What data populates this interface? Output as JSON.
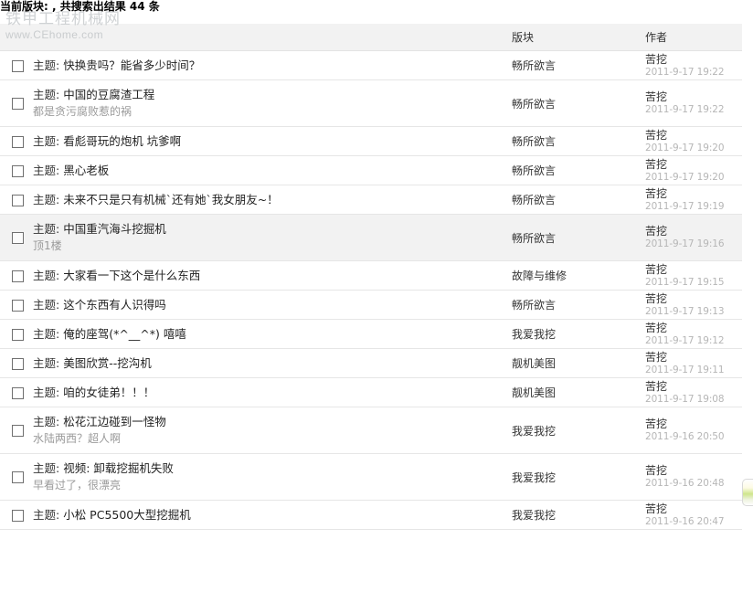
{
  "summary": {
    "text": "当前版块: , 共搜索出结果 44 条"
  },
  "watermark": {
    "cn": "铁甲工程机械网",
    "en": "www.CEhome.com"
  },
  "table": {
    "headers": {
      "checkbox": "",
      "title": "",
      "forum": "版块",
      "author": "作者"
    },
    "rows": [
      {
        "title_label": "主题:",
        "title": "快换贵吗？能省多少时间？",
        "sub": "",
        "forum": "畅所欲言",
        "author": "苦挖",
        "date": "2011-9-17 19:22",
        "highlight": false
      },
      {
        "title_label": "主题:",
        "title": "中国的豆腐渣工程",
        "sub": "都是贪污腐败惹的祸",
        "forum": "畅所欲言",
        "author": "苦挖",
        "date": "2011-9-17 19:22",
        "highlight": false
      },
      {
        "title_label": "主题:",
        "title": "看彪哥玩的炮机 坑爹啊",
        "sub": "",
        "forum": "畅所欲言",
        "author": "苦挖",
        "date": "2011-9-17 19:20",
        "highlight": false
      },
      {
        "title_label": "主题:",
        "title": "黑心老板",
        "sub": "",
        "forum": "畅所欲言",
        "author": "苦挖",
        "date": "2011-9-17 19:20",
        "highlight": false
      },
      {
        "title_label": "主题:",
        "title": "未来不只是只有机械`还有她`我女朋友~！",
        "sub": "",
        "forum": "畅所欲言",
        "author": "苦挖",
        "date": "2011-9-17 19:19",
        "highlight": false
      },
      {
        "title_label": "主题:",
        "title": "中国重汽海斗挖掘机",
        "sub": "顶1楼",
        "forum": "畅所欲言",
        "author": "苦挖",
        "date": "2011-9-17 19:16",
        "highlight": true
      },
      {
        "title_label": "主题:",
        "title": "大家看一下这个是什么东西",
        "sub": "",
        "forum": "故障与维修",
        "author": "苦挖",
        "date": "2011-9-17 19:15",
        "highlight": false
      },
      {
        "title_label": "主题:",
        "title": "这个东西有人识得吗",
        "sub": "",
        "forum": "畅所欲言",
        "author": "苦挖",
        "date": "2011-9-17 19:13",
        "highlight": false
      },
      {
        "title_label": "主题:",
        "title": "俺的座驾(*^__^*) 嘻嘻",
        "sub": "",
        "forum": "我爱我挖",
        "author": "苦挖",
        "date": "2011-9-17 19:12",
        "highlight": false
      },
      {
        "title_label": "主题:",
        "title": "美图欣赏--挖沟机",
        "sub": "",
        "forum": "靓机美图",
        "author": "苦挖",
        "date": "2011-9-17 19:11",
        "highlight": false
      },
      {
        "title_label": "主题:",
        "title": "咱的女徒弟！！！",
        "sub": "",
        "forum": "靓机美图",
        "author": "苦挖",
        "date": "2011-9-17 19:08",
        "highlight": false
      },
      {
        "title_label": "主题:",
        "title": "松花江边碰到一怪物",
        "sub": "水陆两西？超人啊",
        "forum": "我爱我挖",
        "author": "苦挖",
        "date": "2011-9-16 20:50",
        "highlight": false
      },
      {
        "title_label": "主题:",
        "title": "视频: 卸载挖掘机失败",
        "sub": "早看过了，很漂亮",
        "forum": "我爱我挖",
        "author": "苦挖",
        "date": "2011-9-16 20:48",
        "highlight": false
      },
      {
        "title_label": "主题:",
        "title": "小松 PC5500大型挖掘机",
        "sub": "",
        "forum": "我爱我挖",
        "author": "苦挖",
        "date": "2011-9-16 20:47",
        "highlight": false
      }
    ]
  }
}
